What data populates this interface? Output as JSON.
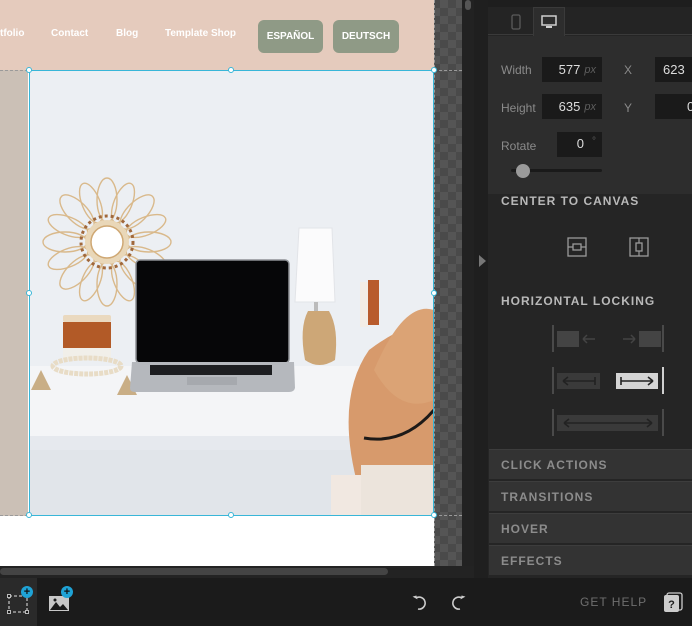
{
  "canvas": {
    "nav_links": [
      "tfolio",
      "Contact",
      "Blog",
      "Template Shop"
    ],
    "language_buttons": [
      "ESPAÑOL",
      "DEUTSCH"
    ],
    "colors": {
      "header_bg": "#e5cbbd",
      "button_bg": "#8f9a86",
      "selection": "#38b6d8"
    },
    "hero_image": "desk-with-laptop-lamp-mirror-hat"
  },
  "panel": {
    "tabs": [
      {
        "name": "mobile",
        "icon": "mobile-icon",
        "active": false
      },
      {
        "name": "desktop",
        "icon": "desktop-icon",
        "active": true
      }
    ],
    "width": {
      "label": "Width",
      "value": "577",
      "unit": "px"
    },
    "height": {
      "label": "Height",
      "value": "635",
      "unit": "px"
    },
    "x": {
      "label": "X",
      "value": "623"
    },
    "y": {
      "label": "Y",
      "value": "0"
    },
    "rotate": {
      "label": "Rotate",
      "value": "0",
      "unit": "°",
      "slider_value": 0
    },
    "center_to_canvas": {
      "title": "CENTER TO CANVAS",
      "buttons": [
        "center-horizontal-icon",
        "center-vertical-icon"
      ]
    },
    "horizontal_locking": {
      "title": "HORIZONTAL LOCKING",
      "options": [
        {
          "name": "lock-none",
          "active": false
        },
        {
          "name": "lock-left",
          "active": false
        },
        {
          "name": "lock-right",
          "active": true
        },
        {
          "name": "lock-stretch",
          "active": false
        }
      ]
    },
    "accordions": [
      "CLICK ACTIONS",
      "TRANSITIONS",
      "HOVER",
      "EFFECTS"
    ]
  },
  "toolbar": {
    "add_box": "add-box-icon",
    "add_image": "add-image-icon",
    "undo": "undo-icon",
    "redo": "redo-icon",
    "get_help": "GET HELP",
    "accent": "#1fa3d6"
  }
}
